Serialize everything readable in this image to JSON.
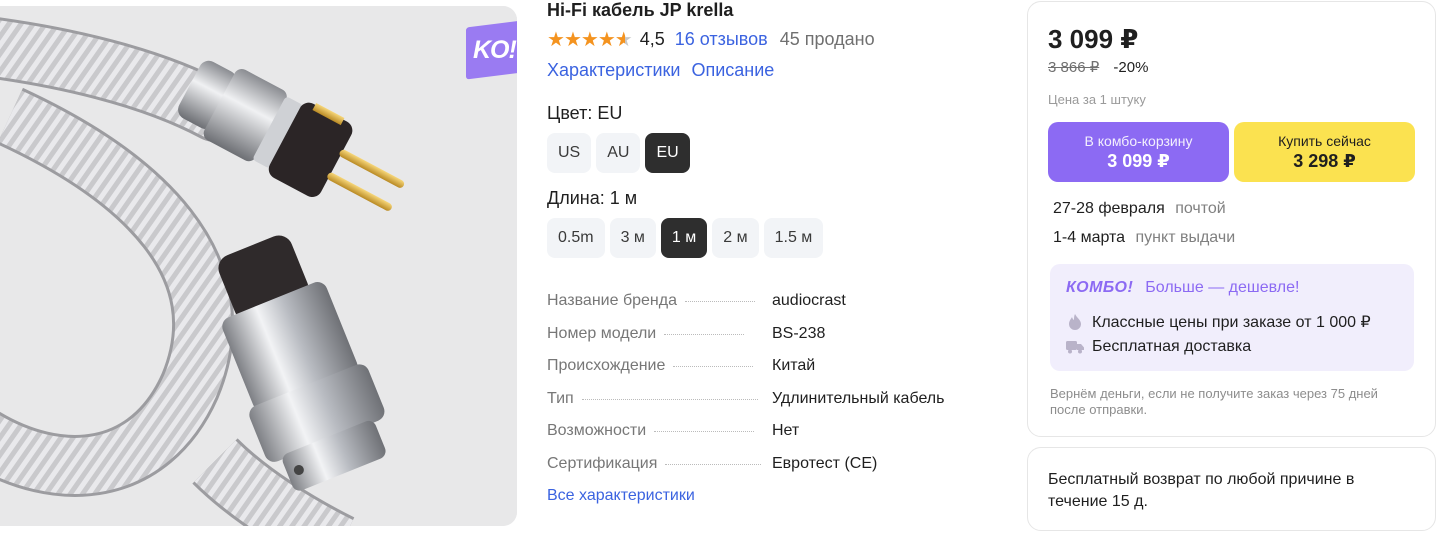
{
  "badge": {
    "text": "KO!"
  },
  "product": {
    "title": "Hi-Fi кабель JP krella",
    "rating": "4,5",
    "rating_value": 4.5,
    "reviews": "16 отзывов",
    "sold": "45 продано",
    "links": [
      "Характеристики",
      "Описание"
    ]
  },
  "color_option": {
    "label": "Цвет: EU",
    "chips": [
      {
        "label": "US",
        "active": false
      },
      {
        "label": "AU",
        "active": false
      },
      {
        "label": "EU",
        "active": true
      }
    ]
  },
  "length_option": {
    "label": "Длина: 1 м",
    "chips": [
      {
        "label": "0.5m",
        "active": false
      },
      {
        "label": "3 м",
        "active": false
      },
      {
        "label": "1 м",
        "active": true
      },
      {
        "label": "2 м",
        "active": false
      },
      {
        "label": "1.5 м",
        "active": false
      }
    ]
  },
  "specs": [
    {
      "key": "Название бренда",
      "value": "audiocrast"
    },
    {
      "key": "Номер модели",
      "value": "BS-238"
    },
    {
      "key": "Происхождение",
      "value": "Китай"
    },
    {
      "key": "Тип",
      "value": "Удлинительный кабель"
    },
    {
      "key": "Возможности",
      "value": "Нет"
    },
    {
      "key": "Сертификация",
      "value": "Евротест (CE)"
    }
  ],
  "all_specs_link": "Все характеристики",
  "buy": {
    "price": "3 099 ₽",
    "old_price": "3 866 ₽",
    "discount": "-20%",
    "unit_note": "Цена за 1 штуку",
    "combo_button": {
      "line1": "В комбо-корзину",
      "line2": "3 099 ₽"
    },
    "buy_button": {
      "line1": "Купить сейчас",
      "line2": "3 298 ₽"
    },
    "delivery": [
      {
        "when": "27-28 февраля",
        "how": "почтой"
      },
      {
        "when": "1-4 марта",
        "how": "пункт выдачи"
      }
    ],
    "combo": {
      "logo": "КОМБО!",
      "slogan": "Больше — дешевле!",
      "items": [
        {
          "icon": "flame-icon",
          "text": "Классные цены при заказе от 1 000 ₽"
        },
        {
          "icon": "truck-icon",
          "text": "Бесплатная доставка"
        }
      ]
    },
    "refund_note": "Вернём деньги, если не получите заказ через 75 дней после отправки."
  },
  "return_card": {
    "text": "Бесплатный возврат по любой причине в течение 15 д."
  },
  "colors": {
    "accent_blue": "#3b63e0",
    "combo_purple": "#8c6af3",
    "buy_yellow": "#fbe250",
    "star_orange": "#f4931f"
  }
}
